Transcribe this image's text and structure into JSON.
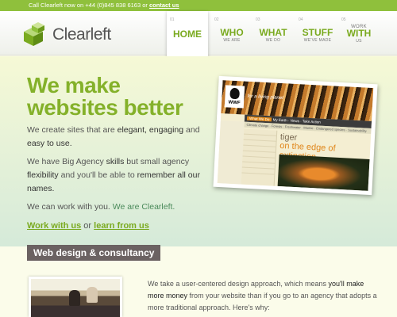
{
  "topbar": {
    "text": "Call Clearleft now on +44 (0)845 838 6163 or ",
    "link": "contact us"
  },
  "logo": {
    "text": "Clearleft"
  },
  "nav": [
    {
      "num": "01",
      "main": "HOME",
      "sub": ""
    },
    {
      "num": "02",
      "main": "WHO",
      "sub": "WE ARE"
    },
    {
      "num": "03",
      "main": "WHAT",
      "sub": "WE DO"
    },
    {
      "num": "04",
      "main": "STUFF",
      "sub": "WE'VE MADE"
    },
    {
      "num": "05",
      "main": "WITH",
      "pre": "WORK",
      "sub": "US"
    }
  ],
  "hero": {
    "headline": "We make websites better",
    "p1_a": "We create sites that are ",
    "p1_b": "elegant, engaging",
    "p1_c": " and ",
    "p1_d": "easy to use.",
    "p2_a": "We have Big Agency ",
    "p2_b": "skills",
    "p2_c": " but small agency ",
    "p2_d": "flexibility",
    "p2_e": " and you'll be able to ",
    "p2_f": "remember all our names.",
    "p3_a": "We can work with you. ",
    "p3_b": "We are Clearleft.",
    "link1": "Work with us",
    "or": " or ",
    "link2": "learn from us"
  },
  "screenshot": {
    "tagline": "for a living planet",
    "logo": "WWF",
    "menu": [
      "Climate change",
      "Forests",
      "Freshwater",
      "Marine",
      "Endangered species",
      "Sustainability"
    ],
    "tabs": [
      "What We Do",
      "My Earth",
      "News",
      "Take Action"
    ],
    "title1": "tiger",
    "title2": "on the edge of extinction"
  },
  "section": {
    "label": "Web design & consultancy",
    "text_a": "We take a user-centered design approach, which means ",
    "text_b": "you'll make more money",
    "text_c": " from your website than if you go to an agency that adopts a more traditional approach. Here's why:"
  },
  "colors": {
    "brand_green": "#84b12a",
    "topbar_green": "#8fc03c",
    "label_bg": "#6b6262"
  }
}
